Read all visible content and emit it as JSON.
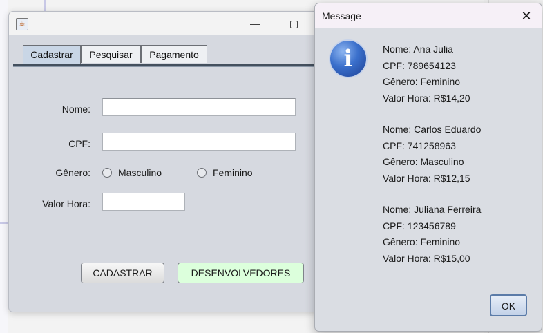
{
  "main_window": {
    "tabs": [
      {
        "label": "Cadastrar",
        "active": true
      },
      {
        "label": "Pesquisar",
        "active": false
      },
      {
        "label": "Pagamento",
        "active": false
      }
    ],
    "form": {
      "nome_label": "Nome:",
      "nome_value": "",
      "cpf_label": "CPF:",
      "cpf_value": "",
      "genero_label": "Gênero:",
      "genero_options": [
        "Masculino",
        "Feminino"
      ],
      "valor_label": "Valor Hora:",
      "valor_value": ""
    },
    "buttons": {
      "cadastrar": "CADASTRAR",
      "desenvolvedores": "DESENVOLVEDORES"
    }
  },
  "dialog": {
    "title": "Message",
    "close_icon": "close-icon",
    "icon": "info-icon",
    "records": [
      {
        "nome": "Nome: Ana Julia",
        "cpf": "CPF: 789654123",
        "genero": "Gênero: Feminino",
        "valor": "Valor Hora: R$14,20"
      },
      {
        "nome": "Nome: Carlos Eduardo",
        "cpf": "CPF: 741258963",
        "genero": "Gênero: Masculino",
        "valor": "Valor Hora: R$12,15"
      },
      {
        "nome": "Nome: Juliana Ferreira",
        "cpf": "CPF: 123456789",
        "genero": "Gênero: Feminino",
        "valor": "Valor Hora: R$15,00"
      }
    ],
    "ok_label": "OK"
  },
  "colors": {
    "window_bg": "#d6d9e0",
    "active_tab": "#c9d6e6",
    "dev_button_bg": "#dcffdc",
    "info_icon": "#3a6fcb"
  }
}
